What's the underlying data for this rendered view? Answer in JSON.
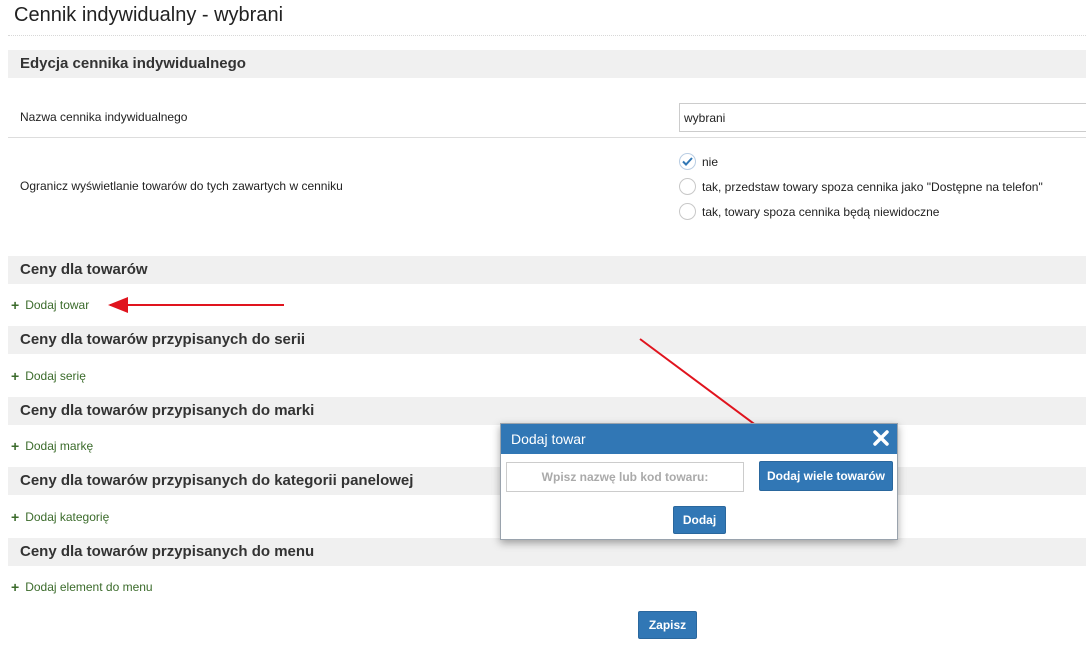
{
  "page": {
    "title": "Cennik indywidualny - wybrani"
  },
  "edit_section": {
    "header": "Edycja cennika indywidualnego",
    "name_label": "Nazwa cennika indywidualnego",
    "name_value": "wybrani",
    "limit_label": "Ogranicz wyświetlanie towarów do tych zawartych w cenniku",
    "options": [
      {
        "label": "nie",
        "checked": true
      },
      {
        "label": "tak, przedstaw towary spoza cennika jako \"Dostępne na telefon\"",
        "checked": false
      },
      {
        "label": "tak, towary spoza cennika będą niewidoczne",
        "checked": false
      }
    ]
  },
  "sections": [
    {
      "header": "Ceny dla towarów",
      "add_label": "Dodaj towar"
    },
    {
      "header": "Ceny dla towarów przypisanych do serii",
      "add_label": "Dodaj serię"
    },
    {
      "header": "Ceny dla towarów przypisanych do marki",
      "add_label": "Dodaj markę"
    },
    {
      "header": "Ceny dla towarów przypisanych do kategorii panelowej",
      "add_label": "Dodaj kategorię"
    },
    {
      "header": "Ceny dla towarów przypisanych do menu",
      "add_label": "Dodaj element do menu"
    }
  ],
  "save_button": "Zapisz",
  "modal": {
    "title": "Dodaj towar",
    "input_placeholder": "Wpisz nazwę lub kod towaru:",
    "add_many_label": "Dodaj wiele towarów",
    "add_label": "Dodaj"
  },
  "colors": {
    "accent": "#3177b5",
    "link": "#3b6b2b",
    "annotation_arrow": "#e0141e",
    "section_bg": "#f0f0f0"
  },
  "icons": {
    "add": "plus-icon",
    "close": "close-icon",
    "checked": "checkmark-icon"
  }
}
